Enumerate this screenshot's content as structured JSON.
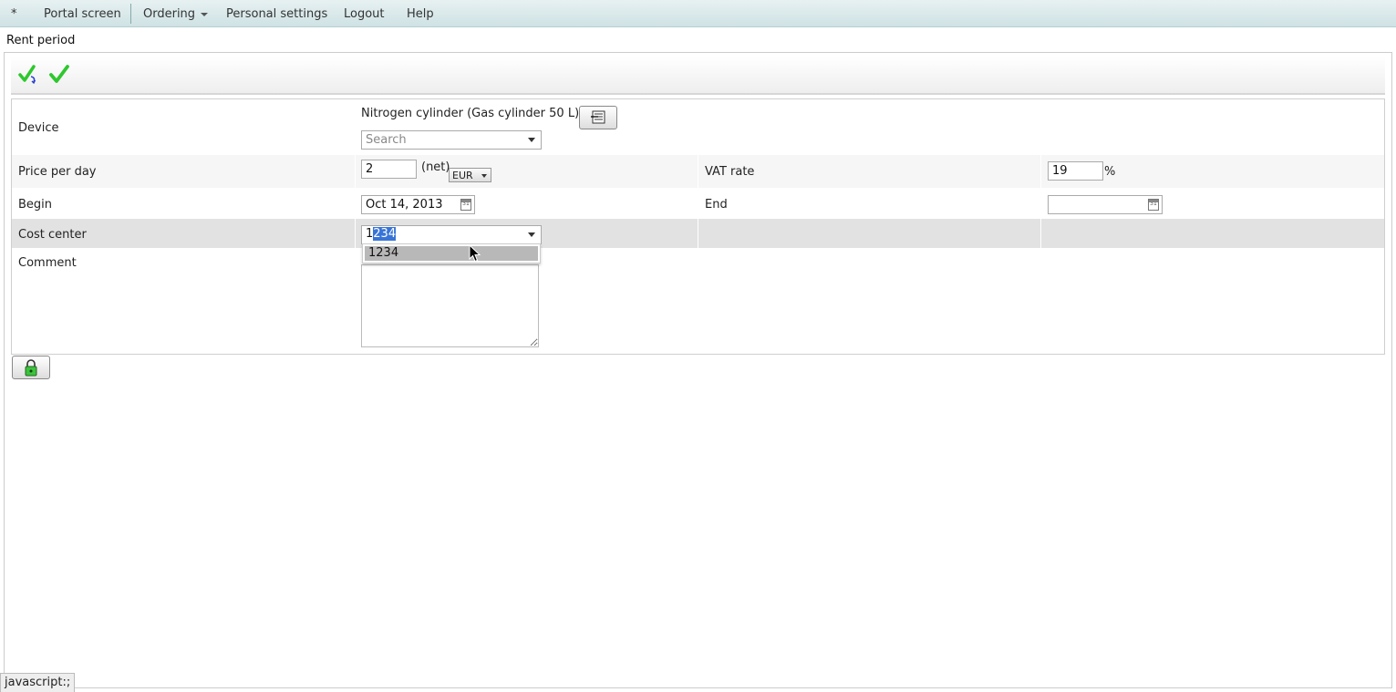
{
  "menu": {
    "star": "*",
    "portal": "Portal screen",
    "ordering": "Ordering",
    "personal_settings": "Personal settings",
    "logout": "Logout",
    "help": "Help"
  },
  "panel_title": "Rent period",
  "toolbar": {
    "save_and_return_icon": "check-with-arrow-icon",
    "save_icon": "check-icon"
  },
  "form": {
    "device": {
      "label": "Device",
      "value": "Nitrogen cylinder (Gas cylinder 50 L)",
      "search_placeholder": "Search"
    },
    "price_per_day": {
      "label": "Price per day",
      "value": "2",
      "net": "(net)",
      "currency": "EUR"
    },
    "vat_rate": {
      "label": "VAT rate",
      "value": "19",
      "unit": "%"
    },
    "begin": {
      "label": "Begin",
      "value": "Oct 14, 2013"
    },
    "end": {
      "label": "End",
      "value": ""
    },
    "cost_center": {
      "label": "Cost center",
      "typed": "1",
      "autocomplete": "234",
      "options": [
        "1234"
      ]
    },
    "comment": {
      "label": "Comment",
      "value": ""
    }
  },
  "lock_icon": "padlock-icon",
  "status_bar": "javascript:;",
  "colors": {
    "menubar": "#d8e9eb",
    "check_green": "#2ec72e",
    "selection": "#3874d8"
  }
}
